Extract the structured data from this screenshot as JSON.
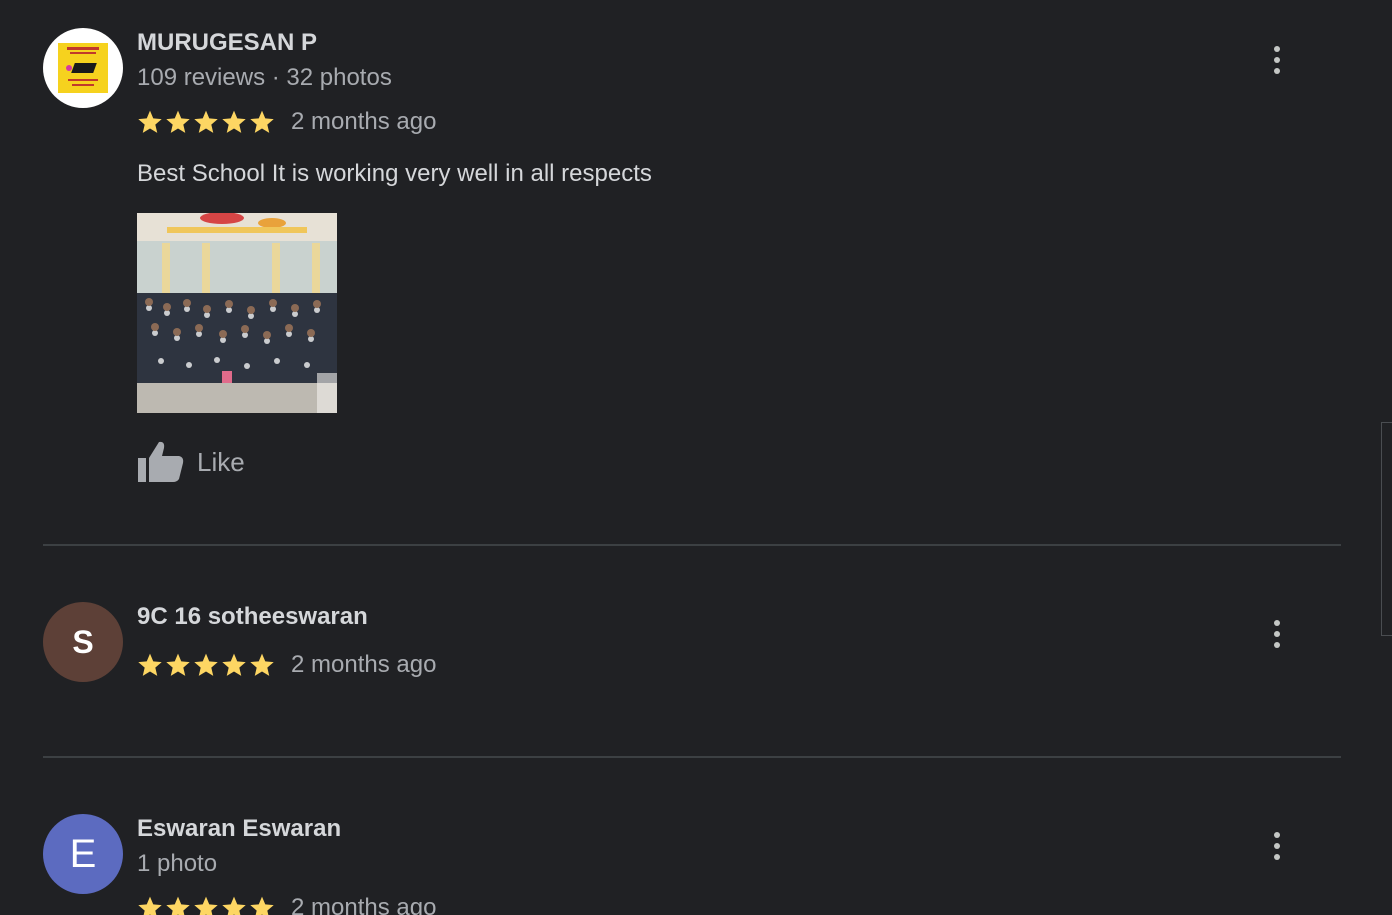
{
  "reviews": [
    {
      "name": "MURUGESAN P",
      "meta": "109 reviews · 32 photos",
      "rating": 5,
      "time": "2 months ago",
      "text": "Best School It is working very well in all respects",
      "like_label": "Like",
      "avatar_type": "logo"
    },
    {
      "name": "9C 16 sotheeswaran",
      "rating": 5,
      "time": "2 months ago",
      "avatar_letter": "S",
      "avatar_color": "#5d4037"
    },
    {
      "name": "Eswaran Eswaran",
      "meta": "1 photo",
      "rating": 5,
      "time": "2 months ago",
      "avatar_letter": "E",
      "avatar_color": "#5c6bc0"
    }
  ],
  "colors": {
    "background": "#202124",
    "star": "#fdd663",
    "divider": "#3c4043"
  },
  "icons": {
    "star": "star-icon",
    "like": "thumbs-up-icon",
    "more": "more-vert-icon"
  }
}
